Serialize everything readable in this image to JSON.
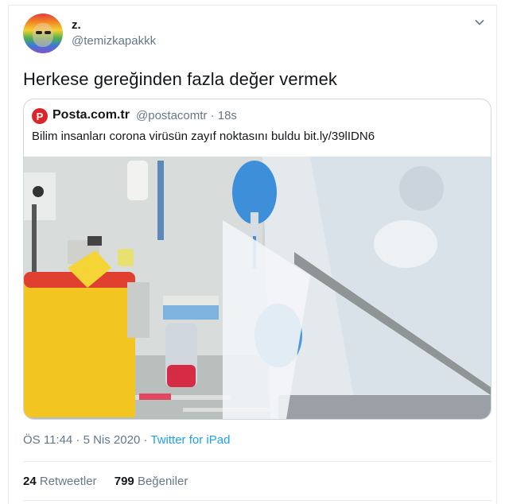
{
  "user": {
    "name": "z.",
    "handle": "@temizkapakkk"
  },
  "tweet": {
    "text": "Herkese gereğinden fazla değer vermek"
  },
  "quoted": {
    "logo_letter": "P",
    "name": "Posta.com.tr",
    "handle": "@postacomtr · 18s",
    "text": "Bilim insanları corona virüsün zayıf noktasını buldu bit.ly/39lIDN6",
    "image_alt": "lab-photo"
  },
  "meta": {
    "time": "ÖS 11:44 · 5 Nis 2020 · ",
    "source": "Twitter for iPad"
  },
  "stats": {
    "retweets_count": "24",
    "retweets_label": "Retweetler",
    "likes_count": "799",
    "likes_label": "Beğeniler"
  },
  "icons": {
    "chevron": "chevron-down-icon"
  }
}
